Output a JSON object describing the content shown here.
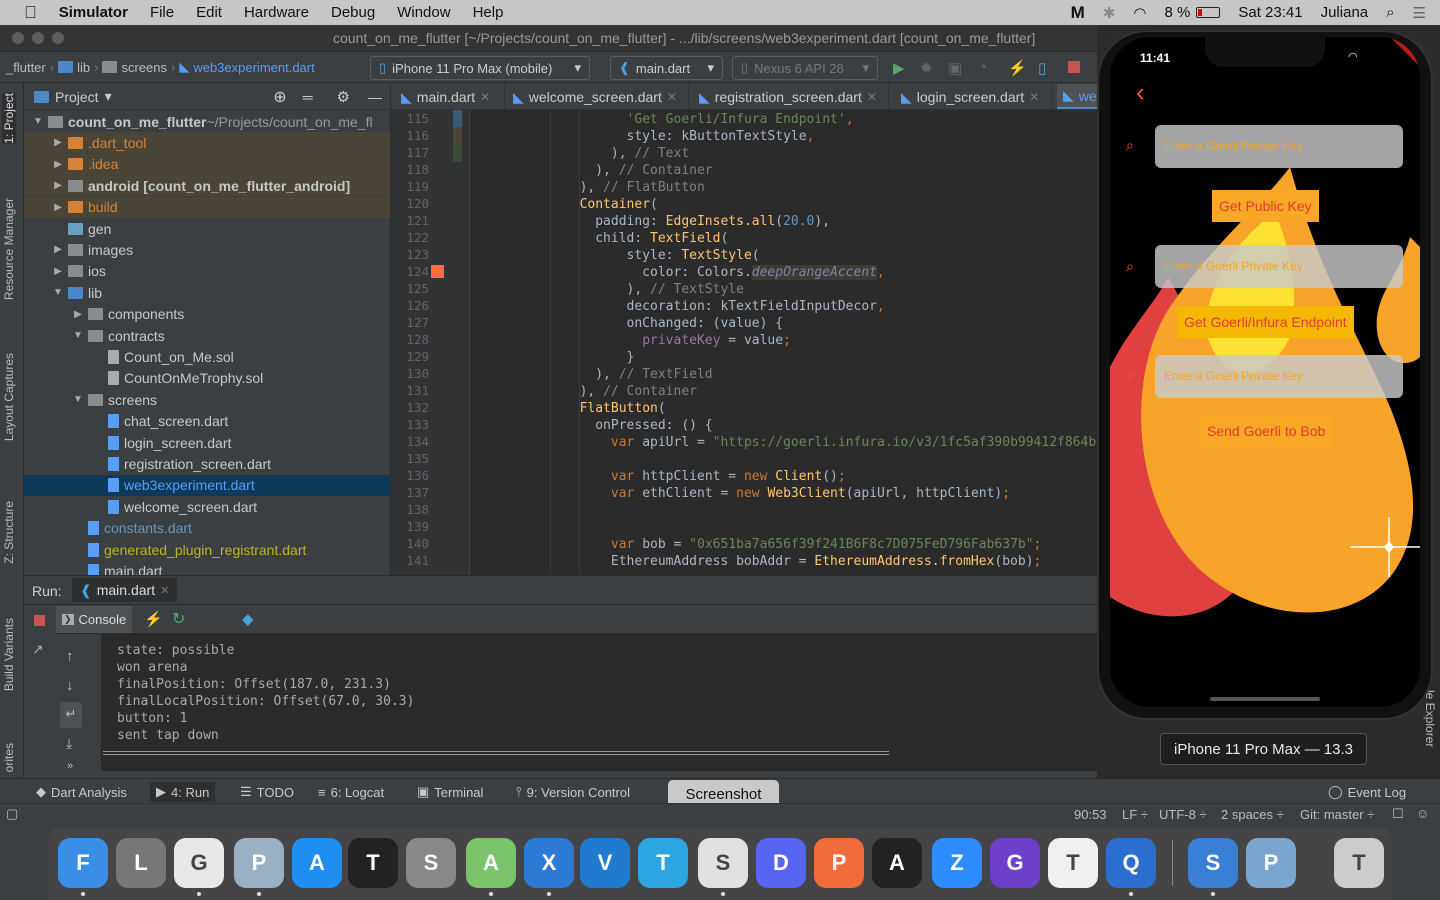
{
  "menubar": {
    "app": "Simulator",
    "items": [
      "File",
      "Edit",
      "Hardware",
      "Debug",
      "Window",
      "Help"
    ],
    "battery": "8 %",
    "clock": "Sat 23:41",
    "user": "Juliana"
  },
  "window": {
    "title": "count_on_me_flutter [~/Projects/count_on_me_flutter] - .../lib/screens/web3experiment.dart [count_on_me_flutter]"
  },
  "navbar": {
    "breadcrumb": [
      "_flutter",
      "lib",
      "screens",
      "web3experiment.dart"
    ],
    "device": "iPhone 11 Pro Max (mobile)",
    "run_config": "main.dart",
    "avd": "Nexus 6 API 28"
  },
  "left_tool_tabs": [
    "1: Project",
    "Resource Manager",
    "Layout Captures",
    "Z: Structure",
    "Build Variants",
    "orites"
  ],
  "project": {
    "header": "Project",
    "tree": [
      {
        "label": "count_on_me_flutter",
        "suffix": " ~/Projects/count_on_me_fl",
        "level": 0,
        "state": "open",
        "type": "folder",
        "bold": true
      },
      {
        "label": ".dart_tool",
        "level": 1,
        "state": "closed",
        "type": "excluded"
      },
      {
        "label": ".idea",
        "level": 1,
        "state": "closed",
        "type": "excluded"
      },
      {
        "label": "android [count_on_me_flutter_android]",
        "level": 1,
        "state": "closed",
        "type": "module",
        "bold": true
      },
      {
        "label": "build",
        "level": 1,
        "state": "closed",
        "type": "excluded"
      },
      {
        "label": "gen",
        "level": 1,
        "state": "none",
        "type": "gen"
      },
      {
        "label": "images",
        "level": 1,
        "state": "closed",
        "type": "folder"
      },
      {
        "label": "ios",
        "level": 1,
        "state": "closed",
        "type": "folder"
      },
      {
        "label": "lib",
        "level": 1,
        "state": "open",
        "type": "source"
      },
      {
        "label": "components",
        "level": 2,
        "state": "closed",
        "type": "folder"
      },
      {
        "label": "contracts",
        "level": 2,
        "state": "open",
        "type": "folder"
      },
      {
        "label": "Count_on_Me.sol",
        "level": 3,
        "state": "none",
        "type": "file"
      },
      {
        "label": "CountOnMeTrophy.sol",
        "level": 3,
        "state": "none",
        "type": "file"
      },
      {
        "label": "screens",
        "level": 2,
        "state": "open",
        "type": "folder"
      },
      {
        "label": "chat_screen.dart",
        "level": 3,
        "state": "none",
        "type": "dart"
      },
      {
        "label": "login_screen.dart",
        "level": 3,
        "state": "none",
        "type": "dart"
      },
      {
        "label": "registration_screen.dart",
        "level": 3,
        "state": "none",
        "type": "dart"
      },
      {
        "label": "web3experiment.dart",
        "level": 3,
        "state": "none",
        "type": "dart",
        "selected": true,
        "color": "#589df6"
      },
      {
        "label": "welcome_screen.dart",
        "level": 3,
        "state": "none",
        "type": "dart"
      },
      {
        "label": "constants.dart",
        "level": 2,
        "state": "none",
        "type": "dart",
        "color": "#6897bb"
      },
      {
        "label": "generated_plugin_registrant.dart",
        "level": 2,
        "state": "none",
        "type": "dart",
        "color": "#bbb529"
      },
      {
        "label": "main.dart",
        "level": 2,
        "state": "none",
        "type": "dart"
      }
    ]
  },
  "editor": {
    "tabs": [
      {
        "label": "main.dart"
      },
      {
        "label": "welcome_screen.dart"
      },
      {
        "label": "registration_screen.dart"
      },
      {
        "label": "login_screen.dart"
      },
      {
        "label": "we",
        "active": true
      }
    ],
    "first_line": 115,
    "lines": [
      [
        [
          "                    ",
          "pl"
        ],
        [
          "'Get Goerli/Infura Endpoint'",
          "str"
        ],
        [
          ",",
          "kw"
        ]
      ],
      [
        [
          "                    style: kButtonTextStyle",
          "pl"
        ],
        [
          ",",
          "kw"
        ]
      ],
      [
        [
          "                  ), ",
          "pl"
        ],
        [
          "// Text",
          "cm"
        ]
      ],
      [
        [
          "                ), ",
          "pl"
        ],
        [
          "// Container",
          "cm"
        ]
      ],
      [
        [
          "              ), ",
          "pl"
        ],
        [
          "// FlatButton",
          "cm"
        ]
      ],
      [
        [
          "              ",
          "pl"
        ],
        [
          "Container",
          "cls"
        ],
        [
          "(",
          "pl"
        ]
      ],
      [
        [
          "                padding: ",
          "pl"
        ],
        [
          "EdgeInsets.all",
          "cls"
        ],
        [
          "(",
          "pl"
        ],
        [
          "20.0",
          "num"
        ],
        [
          "),",
          "pl"
        ]
      ],
      [
        [
          "                child: ",
          "pl"
        ],
        [
          "TextField",
          "cls"
        ],
        [
          "(",
          "pl"
        ]
      ],
      [
        [
          "                    style: ",
          "pl"
        ],
        [
          "TextStyle",
          "cls"
        ],
        [
          "(",
          "pl"
        ]
      ],
      [
        [
          "                      color: Colors.",
          "pl"
        ],
        [
          "deepOrangeAccent",
          "ital"
        ],
        [
          ",",
          "kw"
        ]
      ],
      [
        [
          "                    ), ",
          "pl"
        ],
        [
          "// TextStyle",
          "cm"
        ]
      ],
      [
        [
          "                    decoration: kTextFieldInputDecor",
          "pl"
        ],
        [
          ",",
          "kw"
        ]
      ],
      [
        [
          "                    onChanged: (value) {",
          "pl"
        ]
      ],
      [
        [
          "                      ",
          "pl"
        ],
        [
          "privateKey",
          "prop"
        ],
        [
          " = value",
          "pl"
        ],
        [
          ";",
          "kw"
        ]
      ],
      [
        [
          "                    }",
          "pl"
        ]
      ],
      [
        [
          "                ), ",
          "pl"
        ],
        [
          "// TextField",
          "cm"
        ]
      ],
      [
        [
          "              ), ",
          "pl"
        ],
        [
          "// Container",
          "cm"
        ]
      ],
      [
        [
          "              ",
          "pl"
        ],
        [
          "FlatButton",
          "cls"
        ],
        [
          "(",
          "pl"
        ]
      ],
      [
        [
          "                onPressed: () {",
          "pl"
        ]
      ],
      [
        [
          "                  ",
          "pl"
        ],
        [
          "var ",
          "kw"
        ],
        [
          "apiUrl = ",
          "pl"
        ],
        [
          "\"https://goerli.infura.io/v3/1fc5af390b99412f864b",
          "str"
        ]
      ],
      [
        [
          "",
          "pl"
        ]
      ],
      [
        [
          "                  ",
          "pl"
        ],
        [
          "var ",
          "kw"
        ],
        [
          "httpClient = ",
          "pl"
        ],
        [
          "new ",
          "kw"
        ],
        [
          "Client",
          "cls"
        ],
        [
          "()",
          "pl"
        ],
        [
          ";",
          "kw"
        ]
      ],
      [
        [
          "                  ",
          "pl"
        ],
        [
          "var ",
          "kw"
        ],
        [
          "ethClient = ",
          "pl"
        ],
        [
          "new ",
          "kw"
        ],
        [
          "Web3Client",
          "cls"
        ],
        [
          "(apiUrl, httpClient)",
          "pl"
        ],
        [
          ";",
          "kw"
        ]
      ],
      [
        [
          "",
          "pl"
        ]
      ],
      [
        [
          "",
          "pl"
        ]
      ],
      [
        [
          "                  ",
          "pl"
        ],
        [
          "var ",
          "kw"
        ],
        [
          "bob = ",
          "pl"
        ],
        [
          "\"0x651ba7a656f39f241B6F8c7D075FeD796Fab637b\"",
          "str"
        ],
        [
          ";",
          "kw"
        ]
      ],
      [
        [
          "                  EthereumAddress bobAddr = ",
          "pl"
        ],
        [
          "EthereumAddress.fromHex",
          "cls"
        ],
        [
          "(bob)",
          "pl"
        ],
        [
          ";",
          "kw"
        ]
      ]
    ]
  },
  "run": {
    "label": "Run:",
    "tab": "main.dart",
    "console_tab": "Console",
    "console": [
      "state: possible",
      "won arena",
      "finalPosition: Offset(187.0, 231.3)",
      "finalLocalPosition: Offset(67.0, 30.3)",
      "button: 1",
      "sent tap down"
    ]
  },
  "bottom_tabs": [
    "Dart Analysis",
    "4: Run",
    "TODO",
    "6: Logcat",
    "Terminal",
    "9: Version Control"
  ],
  "tooltip": "Screenshot",
  "event_log": "Event Log",
  "status": {
    "position": "90:53",
    "line_sep": "LF ÷",
    "encoding": "UTF-8 ÷",
    "indent": "2 spaces ÷",
    "vcs": "Git: master ÷"
  },
  "right_tool_tab": "le Explorer",
  "simulator": {
    "time": "11:41",
    "banner": "DEBUG",
    "fields": [
      "Enter a Goerli Private Key",
      "Enter a Goerli Private Key",
      "Enter a Goerli Private Key"
    ],
    "buttons": [
      "Get Public Key",
      "Get Goerli/Infura Endpoint",
      "Send Goerli to Bob"
    ],
    "device_label": "iPhone 11 Pro Max — 13.3",
    "colors": {
      "accent": "#ff5722",
      "button": "#f9a825",
      "button_text": "#e53935",
      "flame_red": "#e04040",
      "flame_orange": "#f8a42a",
      "flame_yellow": "#fde232"
    }
  },
  "dock": [
    "Finder",
    "Launchpad",
    "Google Chrome",
    "Preview",
    "App Store",
    "Terminal",
    "System Preferences",
    "Android Studio",
    "Xcode",
    "Visual Studio Code",
    "Telegram",
    "Screenshot",
    "Discord",
    "Postman",
    "Activity Monitor",
    "Zoom",
    "GitHub Desktop",
    "TextEdit",
    "QuickTime Player",
    "Simulator",
    "Preview",
    "Trash"
  ]
}
